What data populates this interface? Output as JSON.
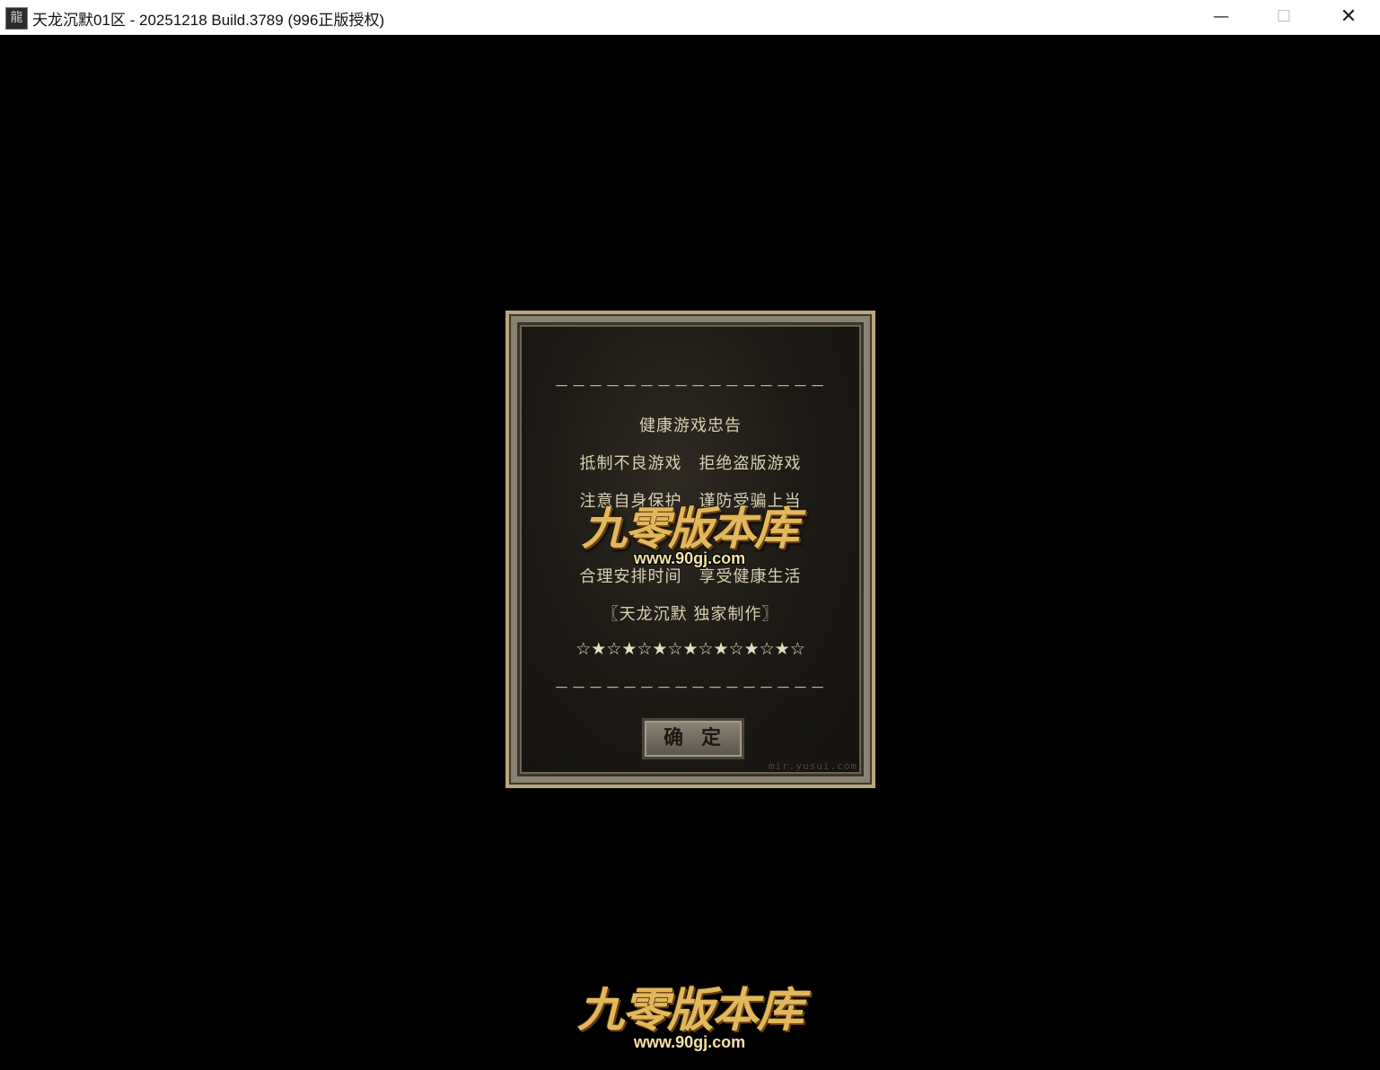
{
  "window": {
    "title": "天龙沉默01区 - 20251218 Build.3789 (996正版授权)",
    "icon_glyph": "龍",
    "minimize_glyph": "—",
    "maximize_glyph": "☐",
    "close_glyph": "✕"
  },
  "dialog": {
    "dash_top": "－－－－－－－－－－－－－－－－",
    "heading": "健康游戏忠告",
    "line1": "抵制不良游戏　拒绝盗版游戏",
    "line2": "注意自身保护　谨防受骗上当",
    "line3": "合理安排时间　享受健康生活",
    "credit": "〖天龙沉默 独家制作〗",
    "stars": "☆★☆★☆★☆★☆★☆★☆★☆",
    "dash_bottom": "－－－－－－－－－－－－－－－－",
    "ok_label": "确定",
    "corner_text": "mir.yusui.com"
  },
  "watermark": {
    "logo_text": "九零版本库",
    "url": "www.90gj.com"
  },
  "colors": {
    "dialog_text": "#d8cfb0",
    "logo_gold": "#e2b85c",
    "background": "#000000"
  }
}
